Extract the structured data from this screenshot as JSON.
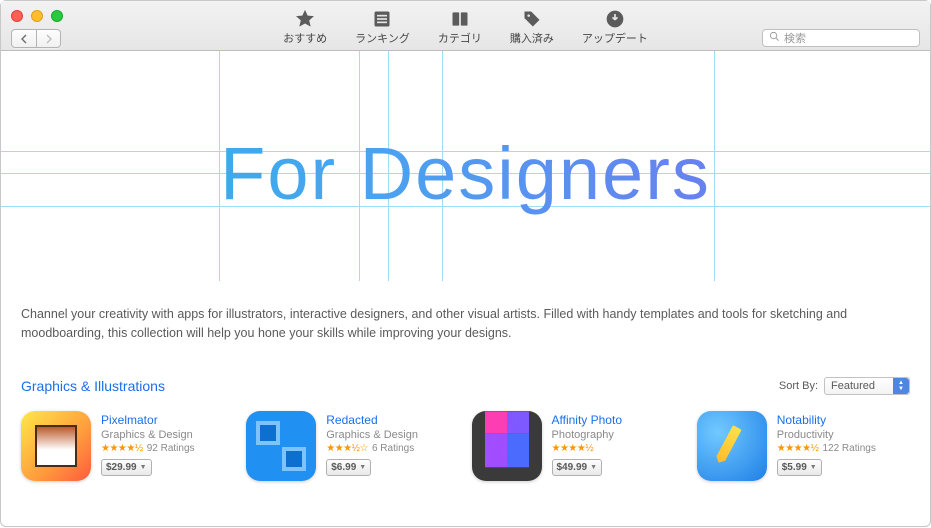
{
  "toolbar": {
    "items": [
      {
        "label": "おすすめ",
        "icon": "star-icon"
      },
      {
        "label": "ランキング",
        "icon": "list-icon"
      },
      {
        "label": "カテゴリ",
        "icon": "grid-icon"
      },
      {
        "label": "購入済み",
        "icon": "tag-icon"
      },
      {
        "label": "アップデート",
        "icon": "download-icon"
      }
    ]
  },
  "search": {
    "placeholder": "検索"
  },
  "hero": {
    "title": "For Designers"
  },
  "description": "Channel your creativity with apps for illustrators, interactive designers, and other visual artists. Filled with handy templates and tools for sketching and moodboarding, this collection will help you hone your skills while improving your designs.",
  "section": {
    "title": "Graphics & Illustrations",
    "sort_label": "Sort By:",
    "sort_value": "Featured"
  },
  "apps": [
    {
      "name": "Pixelmator",
      "category": "Graphics & Design",
      "stars": "★★★★½",
      "ratings": "92 Ratings",
      "price": "$29.99"
    },
    {
      "name": "Redacted",
      "category": "Graphics & Design",
      "stars": "★★★½☆",
      "ratings": "6 Ratings",
      "price": "$6.99"
    },
    {
      "name": "Affinity Photo",
      "category": "Photography",
      "stars": "★★★★½",
      "ratings": "",
      "price": "$49.99"
    },
    {
      "name": "Notability",
      "category": "Productivity",
      "stars": "★★★★½",
      "ratings": "122 Ratings",
      "price": "$5.99"
    }
  ]
}
